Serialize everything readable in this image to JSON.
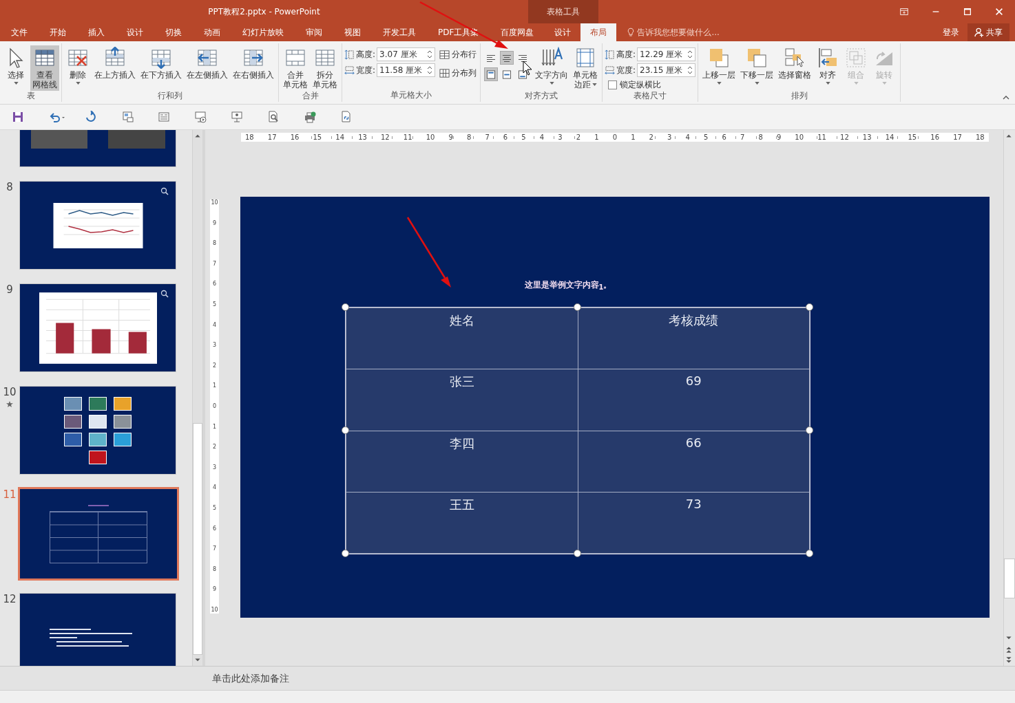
{
  "window": {
    "title": "PPT教程2.pptx - PowerPoint",
    "context_header": "表格工具"
  },
  "menu_tabs": [
    {
      "label": "文件",
      "selected": false,
      "contextual": false
    },
    {
      "label": "开始",
      "selected": false,
      "contextual": false
    },
    {
      "label": "插入",
      "selected": false,
      "contextual": false
    },
    {
      "label": "设计",
      "selected": false,
      "contextual": false
    },
    {
      "label": "切换",
      "selected": false,
      "contextual": false
    },
    {
      "label": "动画",
      "selected": false,
      "contextual": false
    },
    {
      "label": "幻灯片放映",
      "selected": false,
      "contextual": false
    },
    {
      "label": "审阅",
      "selected": false,
      "contextual": false
    },
    {
      "label": "视图",
      "selected": false,
      "contextual": false
    },
    {
      "label": "开发工具",
      "selected": false,
      "contextual": false
    },
    {
      "label": "PDF工具集",
      "selected": false,
      "contextual": false
    },
    {
      "label": "百度网盘",
      "selected": false,
      "contextual": false
    },
    {
      "label": "设计",
      "selected": false,
      "contextual": true
    },
    {
      "label": "布局",
      "selected": true,
      "contextual": true
    }
  ],
  "tell_me": {
    "placeholder": "告诉我您想要做什么..."
  },
  "sign_in": "登录",
  "share": "共享",
  "ribbon": {
    "groups": [
      {
        "label": "表",
        "items": [
          {
            "kind": "large",
            "lines": [
              "选择"
            ],
            "dropdown": true,
            "on": false,
            "disabled": false
          },
          {
            "kind": "large",
            "lines": [
              "查看",
              "网格线"
            ],
            "dropdown": false,
            "on": true,
            "disabled": false
          }
        ]
      },
      {
        "label": "行和列",
        "items": [
          {
            "kind": "large",
            "lines": [
              "删除"
            ],
            "dropdown": true,
            "on": false,
            "disabled": false
          },
          {
            "kind": "large",
            "lines": [
              "在上方插入"
            ],
            "dropdown": false,
            "on": false,
            "disabled": false
          },
          {
            "kind": "large",
            "lines": [
              "在下方插入"
            ],
            "dropdown": false,
            "on": false,
            "disabled": false
          },
          {
            "kind": "large",
            "lines": [
              "在左侧插入"
            ],
            "dropdown": false,
            "on": false,
            "disabled": false
          },
          {
            "kind": "large",
            "lines": [
              "在右侧插入"
            ],
            "dropdown": false,
            "on": false,
            "disabled": false
          }
        ]
      },
      {
        "label": "合并",
        "items": [
          {
            "kind": "large",
            "lines": [
              "合并",
              "单元格"
            ],
            "dropdown": false,
            "on": false,
            "disabled": false
          },
          {
            "kind": "large",
            "lines": [
              "拆分",
              "单元格"
            ],
            "dropdown": false,
            "on": false,
            "disabled": false
          }
        ]
      },
      {
        "label": "单元格大小",
        "items": [
          {
            "kind": "sizes",
            "fields": [
              {
                "label": "高度:",
                "value": "3.07 厘米"
              },
              {
                "label": "宽度:",
                "value": "11.58 厘米"
              }
            ],
            "actions": [
              "分布行",
              "分布列"
            ]
          }
        ]
      },
      {
        "label": "对齐方式",
        "items": [
          {
            "kind": "align",
            "rows": [
              {
                "buttons": [
                  {
                    "selected": false
                  },
                  {
                    "selected": true
                  },
                  {
                    "selected": false
                  }
                ]
              },
              {
                "buttons": [
                  {
                    "selected": true
                  },
                  {
                    "selected": false
                  },
                  {
                    "selected": false
                  }
                ]
              }
            ]
          },
          {
            "kind": "large",
            "lines": [
              "文字方向"
            ],
            "dropdown": true,
            "on": false,
            "disabled": false
          },
          {
            "kind": "large",
            "lines": [
              "单元格",
              "边距"
            ],
            "dropdown": true,
            "on": false,
            "disabled": false
          }
        ]
      },
      {
        "label": "表格尺寸",
        "items": [
          {
            "kind": "sizes",
            "fields": [
              {
                "label": "高度:",
                "value": "12.29 厘米"
              },
              {
                "label": "宽度:",
                "value": "23.15 厘米"
              }
            ],
            "lock": {
              "label": "锁定纵横比",
              "checked": false
            }
          }
        ]
      },
      {
        "label": "排列",
        "items": [
          {
            "kind": "large",
            "lines": [
              "上移一层"
            ],
            "dropdown": true,
            "on": false,
            "disabled": false
          },
          {
            "kind": "large",
            "lines": [
              "下移一层"
            ],
            "dropdown": true,
            "on": false,
            "disabled": false
          },
          {
            "kind": "large",
            "lines": [
              "选择窗格"
            ],
            "dropdown": false,
            "on": false,
            "disabled": false
          },
          {
            "kind": "large",
            "lines": [
              "对齐"
            ],
            "dropdown": true,
            "on": false,
            "disabled": false
          },
          {
            "kind": "large",
            "lines": [
              "组合"
            ],
            "dropdown": true,
            "on": false,
            "disabled": true
          },
          {
            "kind": "large",
            "lines": [
              "旋转"
            ],
            "dropdown": true,
            "on": false,
            "disabled": true
          }
        ]
      }
    ]
  },
  "thumbnails": [
    {
      "kind": "photos",
      "selected": false
    },
    {
      "number": "8",
      "kind": "line-chart",
      "selected": false,
      "zoom": true,
      "animated": false
    },
    {
      "number": "9",
      "kind": "bar-chart",
      "selected": false,
      "zoom": true,
      "animated": false
    },
    {
      "number": "10",
      "kind": "image-grid",
      "selected": false,
      "zoom": false,
      "animated": true
    },
    {
      "number": "11",
      "kind": "table",
      "selected": true,
      "zoom": false,
      "animated": false
    },
    {
      "number": "12",
      "kind": "bullets",
      "selected": false,
      "zoom": false,
      "animated": false
    }
  ],
  "horizontal_ruler": [
    "18",
    "17",
    "16",
    "15",
    "14",
    "13",
    "12",
    "11",
    "10",
    "9",
    "8",
    "7",
    "6",
    "5",
    "4",
    "3",
    "2",
    "1",
    "0",
    "1",
    "2",
    "3",
    "4",
    "5",
    "6",
    "7",
    "8",
    "9",
    "10",
    "11",
    "12",
    "13",
    "14",
    "15",
    "16",
    "17",
    "18"
  ],
  "vertical_ruler": [
    "10",
    "9",
    "8",
    "7",
    "6",
    "5",
    "4",
    "3",
    "2",
    "1",
    "0",
    "1",
    "2",
    "3",
    "4",
    "5",
    "6",
    "7",
    "8",
    "9",
    "10"
  ],
  "slide": {
    "title": "这里是举例文字内容$_{1}$。",
    "table": {
      "selected": true,
      "columns": [
        "姓名",
        "考核成绩"
      ],
      "rows": [
        [
          "张三",
          "69"
        ],
        [
          "李四",
          "66"
        ],
        [
          "王五",
          "73"
        ]
      ]
    }
  },
  "notes": {
    "placeholder": "单击此处添加备注"
  }
}
